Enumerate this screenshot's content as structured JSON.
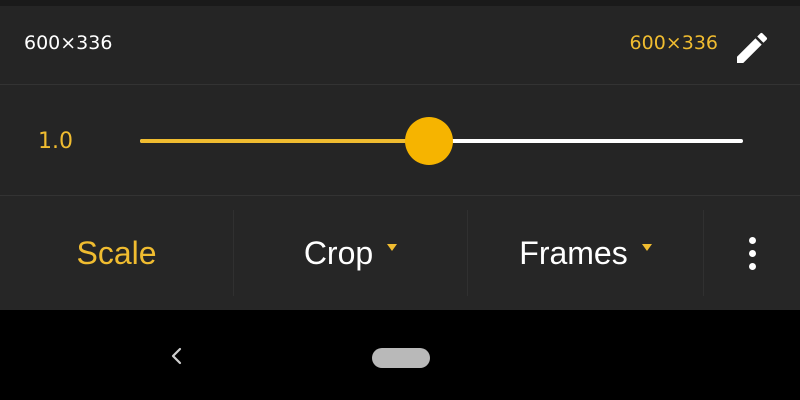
{
  "info": {
    "original_size": "600×336",
    "output_size": "600×336",
    "edit_icon": "pencil-icon"
  },
  "slider": {
    "value_label": "1.0",
    "position_fraction": 0.48
  },
  "tabs": [
    {
      "label": "Scale",
      "active": true,
      "has_dropdown": false
    },
    {
      "label": "Crop",
      "active": false,
      "has_dropdown": true
    },
    {
      "label": "Frames",
      "active": false,
      "has_dropdown": true
    }
  ],
  "overflow_icon": "more-vert-icon",
  "navigation": {
    "back_icon": "back-chevron-icon",
    "home_icon": "home-pill-icon"
  },
  "colors": {
    "accent": "#f0bc30",
    "thumb": "#f6b400",
    "background": "#222222",
    "text": "#ffffff"
  }
}
